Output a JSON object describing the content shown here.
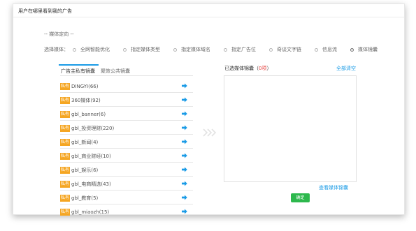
{
  "header": {
    "title": "用户在哪里看到我的广告"
  },
  "media_section": {
    "label": "-- 媒体定向 --"
  },
  "media_select": {
    "label": "选择媒体：",
    "options": [
      "全网智能优化",
      "指定媒体类型",
      "指定媒体域名",
      "指定广告位",
      "奇谈文字链",
      "信息流",
      "媒体镜囊"
    ],
    "selected_index": 6
  },
  "library": {
    "tabs": [
      "广告主私有镜囊",
      "聚效公共镜囊"
    ],
    "active_tab": 0,
    "tag_label": "私有",
    "items": [
      "DINGYI(66)",
      "360媒体(92)",
      "gbl_banner(6)",
      "gbl_投资理财(220)",
      "gbl_新闻(4)",
      "gbl_商业财经(10)",
      "gbl_娱乐(6)",
      "gbl_电商精选(43)",
      "gbl_教育(5)",
      "gbl_miaozh(15)"
    ]
  },
  "selected": {
    "title_prefix": "已选媒体锦囊（",
    "count": "0项",
    "title_suffix": "）",
    "clear_all": "全部清空",
    "view_link": "查看媒体锦囊",
    "confirm": "确定"
  },
  "colors": {
    "accent": "#1a9be6",
    "tag": "#f5a623",
    "confirm": "#2db84d",
    "count": "#e53935"
  },
  "icons": {
    "row_action": "arrow-right-icon",
    "transfer": "double-chevron-right-icon"
  }
}
